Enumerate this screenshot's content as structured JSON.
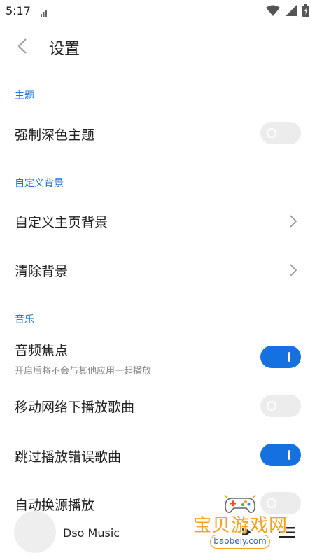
{
  "status_bar": {
    "time": "5:17",
    "icons": [
      "signal-bars-mini-icon",
      "wifi-icon",
      "cell-signal-icon",
      "battery-charging-icon"
    ]
  },
  "app_bar": {
    "back_icon": "chevron-left-icon",
    "title": "设置"
  },
  "sections": {
    "theme": {
      "header": "主题",
      "force_dark": {
        "label": "强制深色主题",
        "on": false
      }
    },
    "background": {
      "header": "自定义背景",
      "custom_home": {
        "label": "自定义主页背景"
      },
      "clear": {
        "label": "清除背景"
      }
    },
    "music": {
      "header": "音乐",
      "audio_focus": {
        "label": "音频焦点",
        "sub": "开启后将不会与其他应用一起播放",
        "on": true
      },
      "mobile_data": {
        "label": "移动网络下播放歌曲",
        "on": false
      },
      "skip_error": {
        "label": "跳过播放错误歌曲",
        "on": true
      },
      "auto_source": {
        "label": "自动换源播放",
        "on": false
      }
    }
  },
  "player": {
    "title": "Dso Music",
    "icons": [
      "play-icon",
      "queue-list-icon"
    ]
  },
  "watermark": {
    "title": "宝贝游戏网",
    "url": "baobeiy.com"
  },
  "colors": {
    "accent": "#1e72d8",
    "toggle_on": "#1570e0",
    "toggle_off": "#ececec",
    "watermark_orange": "#f6a21a"
  }
}
